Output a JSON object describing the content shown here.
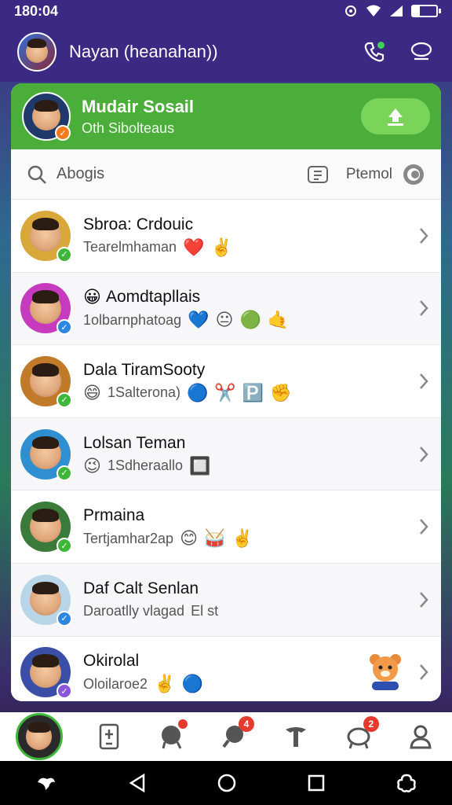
{
  "status_bar": {
    "time": "180:04"
  },
  "app_bar": {
    "title": "Nayan (heanahan))"
  },
  "profile": {
    "name": "Mudair Sosail",
    "subtitle": "Oth Sibolteaus"
  },
  "search": {
    "placeholder": "Abogis",
    "filter_label": "Ptemol"
  },
  "chats": [
    {
      "name": "Sbroa: Crdouic",
      "preview": "Tearelmhaman",
      "emojis": [
        "❤️",
        "✌️"
      ],
      "badge": "green"
    },
    {
      "name": "Aomdtapllais",
      "name_emoji": "😀",
      "preview": "1olbarnphatoag",
      "emojis": [
        "💙",
        "😐",
        "🟢",
        "🤙"
      ],
      "badge": "blue"
    },
    {
      "name": "Dala TiramSooty",
      "preview": "1Salterona)",
      "name_emoji_preview": "😄",
      "emojis": [
        "🔵",
        "✂️",
        "🅿️",
        "✊"
      ],
      "badge": "green"
    },
    {
      "name": "Lolsan Teman",
      "preview": "1Sdheraallo",
      "name_emoji_preview": "😉",
      "emojis": [
        "🔲"
      ],
      "badge": "green"
    },
    {
      "name": "Prmaina",
      "preview": "Tertjamhar2ap",
      "emojis": [
        "😊",
        "🥁",
        "✌️"
      ],
      "badge": "green"
    },
    {
      "name": "Daf Calt Senlan",
      "preview": "Daroatlly vlagad",
      "preview_suffix": "El st",
      "emojis": [],
      "badge": "blue"
    },
    {
      "name": "Okirolal",
      "preview": "Oloilaroe2",
      "emojis": [
        "✌️",
        "🔵"
      ],
      "badge": "purple"
    }
  ],
  "bottom_nav": {
    "badge_calls": "4",
    "badge_updates": "2"
  },
  "colors": {
    "header_purple": "#3a2a84",
    "profile_green": "#4cae3a",
    "accent_green": "#7bd45a",
    "badge_red": "#e33b2e"
  }
}
